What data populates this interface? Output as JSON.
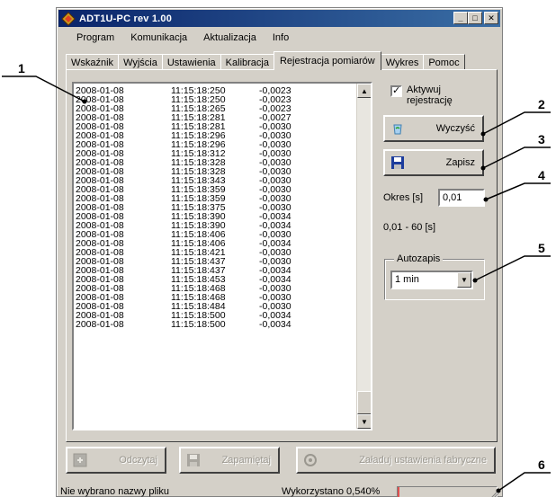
{
  "window": {
    "title": "ADT1U-PC rev 1.00"
  },
  "menu": [
    "Program",
    "Komunikacja",
    "Aktualizacja",
    "Info"
  ],
  "tabs": [
    {
      "label": "Wskaźnik",
      "active": false
    },
    {
      "label": "Wyjścia",
      "active": false
    },
    {
      "label": "Ustawienia",
      "active": false
    },
    {
      "label": "Kalibracja",
      "active": false
    },
    {
      "label": "Rejestracja pomiarów",
      "active": true
    },
    {
      "label": "Wykres",
      "active": false
    },
    {
      "label": "Pomoc",
      "active": false
    }
  ],
  "records": [
    [
      "2008-01-08",
      "11:15:18:250",
      "-0,0023"
    ],
    [
      "2008-01-08",
      "11:15:18:250",
      "-0,0023"
    ],
    [
      "2008-01-08",
      "11:15:18:265",
      "-0,0023"
    ],
    [
      "2008-01-08",
      "11:15:18:281",
      "-0,0027"
    ],
    [
      "2008-01-08",
      "11:15:18:281",
      "-0,0030"
    ],
    [
      "2008-01-08",
      "11:15:18:296",
      "-0,0030"
    ],
    [
      "2008-01-08",
      "11:15:18:296",
      "-0,0030"
    ],
    [
      "2008-01-08",
      "11:15:18:312",
      "-0,0030"
    ],
    [
      "2008-01-08",
      "11:15:18:328",
      "-0,0030"
    ],
    [
      "2008-01-08",
      "11:15:18:328",
      "-0,0030"
    ],
    [
      "2008-01-08",
      "11:15:18:343",
      "-0,0030"
    ],
    [
      "2008-01-08",
      "11:15:18:359",
      "-0,0030"
    ],
    [
      "2008-01-08",
      "11:15:18:359",
      "-0,0030"
    ],
    [
      "2008-01-08",
      "11:15:18:375",
      "-0,0030"
    ],
    [
      "2008-01-08",
      "11:15:18:390",
      "-0,0034"
    ],
    [
      "2008-01-08",
      "11:15:18:390",
      "-0,0034"
    ],
    [
      "2008-01-08",
      "11:15:18:406",
      "-0,0030"
    ],
    [
      "2008-01-08",
      "11:15:18:406",
      "-0,0034"
    ],
    [
      "2008-01-08",
      "11:15:18:421",
      "-0,0030"
    ],
    [
      "2008-01-08",
      "11:15:18:437",
      "-0,0030"
    ],
    [
      "2008-01-08",
      "11:15:18:437",
      "-0,0034"
    ],
    [
      "2008-01-08",
      "11:15:18:453",
      "-0,0034"
    ],
    [
      "2008-01-08",
      "11:15:18:468",
      "-0,0030"
    ],
    [
      "2008-01-08",
      "11:15:18:468",
      "-0,0030"
    ],
    [
      "2008-01-08",
      "11:15:18:484",
      "-0,0030"
    ],
    [
      "2008-01-08",
      "11:15:18:500",
      "-0,0034"
    ],
    [
      "2008-01-08",
      "11:15:18:500",
      "-0,0034"
    ]
  ],
  "panel": {
    "activate_label": "Aktywuj rejestrację",
    "activate_checked": true,
    "clear_label": "Wyczyść",
    "save_label": "Zapisz",
    "period_label": "Okres [s]",
    "period_value": "0,01",
    "range_text": "0,01 - 60 [s]",
    "autosave_title": "Autozapis",
    "autosave_value": "1 min"
  },
  "bottom_buttons": {
    "read_label": "Odczytaj",
    "store_label": "Zapamiętaj",
    "factory_label": "Załaduj ustawienia fabryczne"
  },
  "status": {
    "file_text": "Nie wybrano nazwy pliku",
    "usage_text": "Wykorzystano  0,540%",
    "usage_fraction": 0.0054
  },
  "callouts": [
    "1",
    "2",
    "3",
    "4",
    "5",
    "6"
  ],
  "colors": {
    "title_start": "#0a246a",
    "title_end": "#3a6ea5",
    "progress": "#e05050"
  }
}
